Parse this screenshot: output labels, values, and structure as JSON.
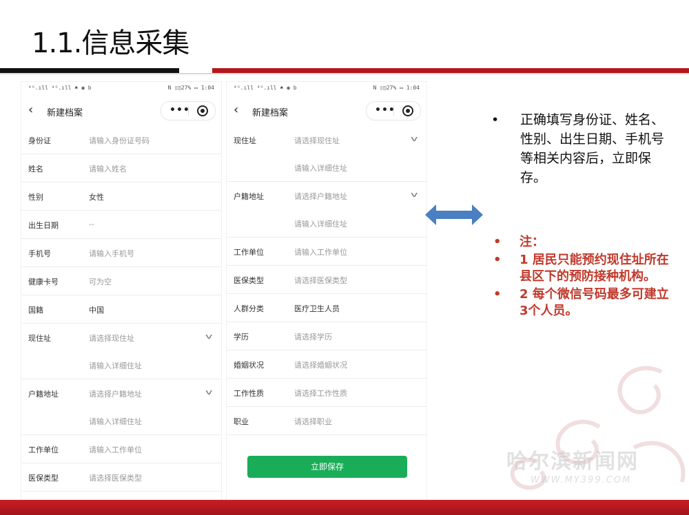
{
  "slide": {
    "title": "1.1.信息采集"
  },
  "phone1": {
    "status_left": "⁴ᴳ.ıll ⁴ᴳ.ıll ♠ ◉ b",
    "status_right": "N ▯◫27% ▭ 1:04",
    "header_title": "新建档案",
    "rows": [
      {
        "label": "身份证",
        "value": "请输入身份证号码"
      },
      {
        "label": "姓名",
        "value": "请输入姓名"
      },
      {
        "label": "性别",
        "value": "女性"
      },
      {
        "label": "出生日期",
        "value": "--"
      },
      {
        "label": "手机号",
        "value": "请输入手机号"
      },
      {
        "label": "健康卡号",
        "value": "可为空"
      },
      {
        "label": "国籍",
        "value": "中国"
      },
      {
        "label": "现住址",
        "value": "请选择现住址"
      },
      {
        "label": "",
        "value": "请输入详细住址"
      },
      {
        "label": "户籍地址",
        "value": "请选择户籍地址"
      },
      {
        "label": "",
        "value": "请输入详细住址"
      },
      {
        "label": "工作单位",
        "value": "请输入工作单位"
      },
      {
        "label": "医保类型",
        "value": "请选择医保类型"
      }
    ]
  },
  "phone2": {
    "status_left": "⁴ᴳ.ıll ⁴ᴳ.ıll ♠ ◉ b",
    "status_right": "N ▯◫27% ▭ 1:04",
    "header_title": "新建档案",
    "rows": [
      {
        "label": "现住址",
        "value": "请选择现住址"
      },
      {
        "label": "",
        "value": "请输入详细住址"
      },
      {
        "label": "户籍地址",
        "value": "请选择户籍地址"
      },
      {
        "label": "",
        "value": "请输入详细住址"
      },
      {
        "label": "工作单位",
        "value": "请输入工作单位"
      },
      {
        "label": "医保类型",
        "value": "请选择医保类型"
      },
      {
        "label": "人群分类",
        "value": "医疗卫生人员"
      },
      {
        "label": "学历",
        "value": "请选择学历"
      },
      {
        "label": "婚姻状况",
        "value": "请选择婚姻状况"
      },
      {
        "label": "工作性质",
        "value": "请选择工作性质"
      },
      {
        "label": "职业",
        "value": "请选择职业"
      }
    ],
    "save_label": "立即保存"
  },
  "right": {
    "bullet_text": "正确填写身份证、姓名、性别、出生日期、手机号等相关内容后，立即保存。",
    "notes": [
      "注：",
      "1 居民只能预约现住址所在县区下的预防接种机构。",
      "2 每个微信号码最多可建立3个人员。"
    ],
    "note_color": "#c0392b"
  },
  "watermark": {
    "line1": "哈尔滨新闻网",
    "line2": "WWW.MY399.COM"
  },
  "colors": {
    "accent_red": "#b5161e",
    "save_green": "#1aad58",
    "arrow_blue": "#4a7fc1"
  }
}
